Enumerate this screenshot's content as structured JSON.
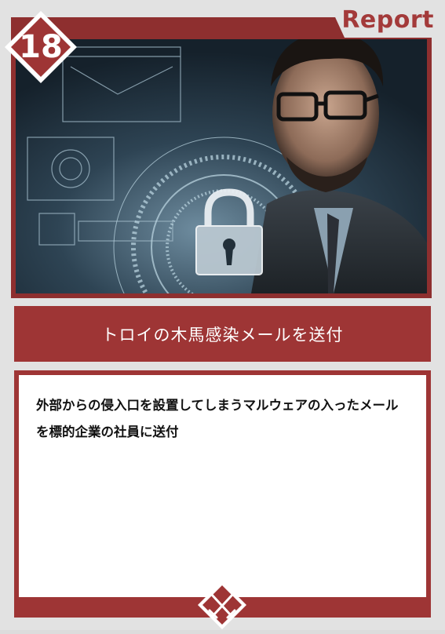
{
  "card": {
    "number": "18",
    "category_label": "Report",
    "title": "トロイの木馬感染メールを送付",
    "description": "外部からの侵入口を設置してしまうマルウェアの入ったメールを標的企業の社員に送付"
  },
  "colors": {
    "accent": "#9e3535",
    "card_background": "#e2e2e2",
    "text_on_accent": "#ffffff"
  },
  "icons": {
    "badge": "diamond-number-badge",
    "emblem": "crossed-swords-emblem-icon",
    "illustration": "lock-hologram-illustration"
  }
}
